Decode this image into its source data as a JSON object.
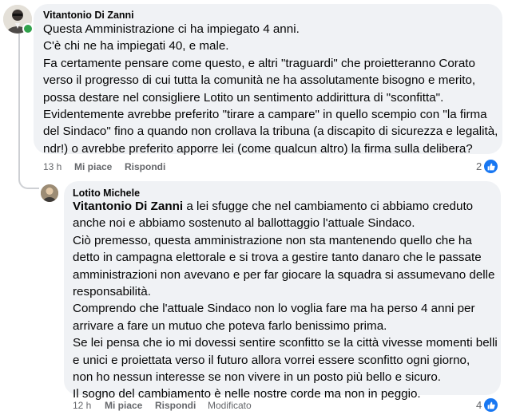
{
  "colors": {
    "bubble": "#f0f2f5",
    "meta_text": "#65676b",
    "like_blue": "#1877f2",
    "online_green": "#31a24c"
  },
  "comments": [
    {
      "author": "Vitantonio Di Zanni",
      "avatar_icon": "person-avatar-icon",
      "online": true,
      "lines": [
        "Questa Amministrazione ci ha impiegato 4 anni.",
        "C'è chi ne ha impiegati 40, e male.",
        "Fa certamente pensare come questo, e altri \"traguardi\" che proietteranno Corato",
        "verso il progresso di cui tutta la comunità ne ha assolutamente bisogno e merito,",
        "possa destare nel consigliere Lotito un sentimento addirittura di \"sconfitta\".",
        "Evidentemente avrebbe preferito \"tirare a campare\" in quello scempio con \"la firma",
        "del Sindaco\" fino a quando non crollava la tribuna (a discapito di sicurezza e legalità,",
        "ndr!) o avrebbe preferito apporre lei (come qualcun altro) la firma sulla delibera?"
      ],
      "time": "13 h",
      "like_label": "Mi piace",
      "reply_label": "Rispondi",
      "reaction_count": "2",
      "reaction_icon": "like-icon"
    },
    {
      "author": "Lotito Michele",
      "avatar_icon": "person-avatar-icon",
      "online": false,
      "mention": "Vitantonio Di Zanni",
      "first_line_rest": " a lei sfugge che nel cambiamento ci abbiamo creduto",
      "lines": [
        "anche noi e abbiamo sostenuto al ballottaggio l'attuale Sindaco.",
        "Ciò premesso, questa amministrazione non sta mantenendo quello che ha",
        "detto in campagna elettorale e si trova a gestire tanto danaro che le passate",
        "amministrazioni non avevano e per far giocare la squadra si assumevano delle",
        "responsabilità.",
        "Comprendo che l'attuale Sindaco non lo voglia fare ma ha perso 4 anni per",
        "arrivare a fare un mutuo che poteva farlo benissimo prima.",
        "Se lei pensa che io mi dovessi sentire sconfitto se la città vivesse momenti belli",
        "e unici e proiettata verso il futuro allora vorrei essere sconfitto ogni giorno,",
        "non ho nessun interesse se non vivere in un posto più bello e sicuro.",
        "Il sogno del cambiamento è nelle nostre corde ma non in peggio."
      ],
      "time": "12 h",
      "like_label": "Mi piace",
      "reply_label": "Rispondi",
      "edited_label": "Modificato",
      "reaction_count": "4",
      "reaction_icon": "like-icon"
    }
  ]
}
